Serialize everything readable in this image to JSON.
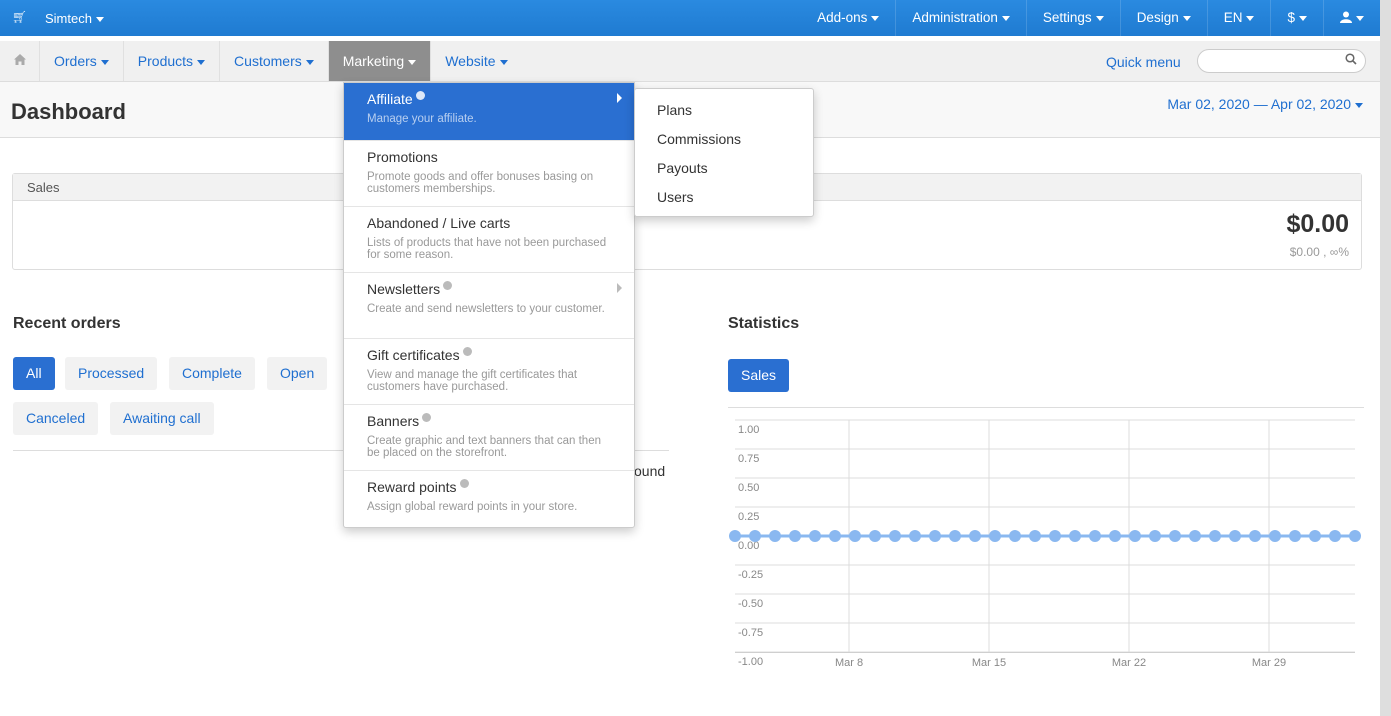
{
  "topbar": {
    "store": "Simtech",
    "right_items": [
      "Add-ons",
      "Administration",
      "Settings",
      "Design",
      "EN",
      "$",
      ""
    ],
    "icons": {
      "cart": "cart-icon",
      "user": "user-icon"
    }
  },
  "nav": {
    "items": [
      "Orders",
      "Products",
      "Customers",
      "Marketing",
      "Website"
    ],
    "active": "Marketing",
    "quick_menu": "Quick menu",
    "search_value": ""
  },
  "header": {
    "title": "Dashboard",
    "date_range": "Mar 02, 2020 — Apr 02, 2020"
  },
  "sales": {
    "title": "Sales",
    "amount": "$0.00",
    "sub": "$0.00 , ∞%"
  },
  "recent_orders": {
    "title": "Recent orders",
    "filters": [
      "All",
      "Processed",
      "Complete",
      "Open",
      "Canceled",
      "Awaiting call"
    ],
    "active_filter": "All",
    "empty_text_fragment": "ound"
  },
  "statistics": {
    "title": "Statistics",
    "tab": "Sales"
  },
  "marketing_menu": {
    "items": [
      {
        "title": "Affiliate",
        "desc": "Manage your affiliate.",
        "badge": true,
        "submenu": true,
        "highlighted": true
      },
      {
        "title": "Promotions",
        "desc": "Promote goods and offer bonuses basing on customers memberships.",
        "badge": false,
        "submenu": false
      },
      {
        "title": "Abandoned / Live carts",
        "desc": "Lists of products that have not been purchased for some reason.",
        "badge": false,
        "submenu": false
      },
      {
        "title": "Newsletters",
        "desc": "Create and send newsletters to your customer.",
        "badge": true,
        "submenu": true
      },
      {
        "title": "Gift certificates",
        "desc": "View and manage the gift certificates that customers have purchased.",
        "badge": true,
        "submenu": false
      },
      {
        "title": "Banners",
        "desc": "Create graphic and text banners that can then be placed on the storefront.",
        "badge": true,
        "submenu": false
      },
      {
        "title": "Reward points",
        "desc": "Assign global reward points in your store.",
        "badge": true,
        "submenu": false
      }
    ]
  },
  "affiliate_submenu": [
    "Plans",
    "Commissions",
    "Payouts",
    "Users"
  ],
  "chart_data": {
    "type": "line",
    "x_ticks": [
      "Mar 8",
      "Mar 15",
      "Mar 22",
      "Mar 29"
    ],
    "y_ticks": [
      "1.00",
      "0.75",
      "0.50",
      "0.25",
      "0.00",
      "-0.25",
      "-0.50",
      "-0.75",
      "-1.00"
    ],
    "ylim": [
      -1,
      1
    ],
    "series": [
      {
        "values": [
          0,
          0,
          0,
          0,
          0,
          0,
          0,
          0,
          0,
          0,
          0,
          0,
          0,
          0,
          0,
          0,
          0,
          0,
          0,
          0,
          0,
          0,
          0,
          0,
          0,
          0,
          0,
          0,
          0,
          0,
          0,
          0
        ]
      }
    ],
    "color": "#8ab8f0"
  }
}
